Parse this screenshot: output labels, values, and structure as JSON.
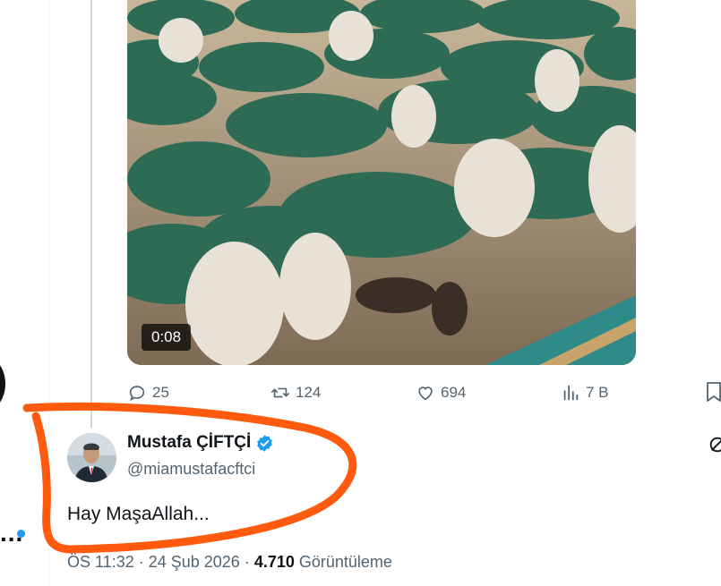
{
  "media": {
    "duration": "0:08"
  },
  "actions": {
    "replies": "25",
    "reposts": "124",
    "likes": "694",
    "views": "7 B"
  },
  "reply": {
    "display_name": "Mustafa ÇİFTÇİ",
    "handle": "@miamustafacftci",
    "text": "Hay MaşaAllah...",
    "meta_prefix": "ÖS 11:32 · 24 Şub 2026 · ",
    "views_count": "4.710",
    "views_label": " Görüntüleme"
  },
  "sidebar": {
    "more_label": "..."
  },
  "icons": {
    "reply": "speech-bubble-icon",
    "repost": "repost-arrows-icon",
    "like": "heart-icon",
    "views": "bar-chart-icon",
    "bookmark": "bookmark-icon",
    "verified": "verified-badge-icon"
  },
  "colors": {
    "accent": "#1d9bf0",
    "annotation": "#ff5a0e",
    "secondary_text": "#536471",
    "primary_text": "#0f1419"
  }
}
